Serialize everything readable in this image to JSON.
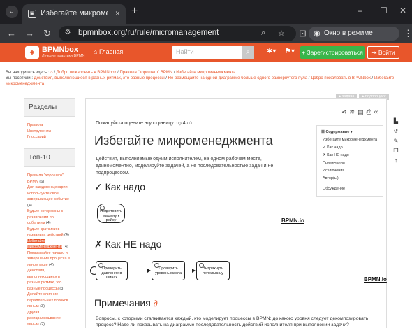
{
  "browser": {
    "tab_title": "Избегайте микроменеджме",
    "tab_close": "×",
    "new_tab": "+",
    "url": "bpmnbox.org/ru/rule/micromanagement",
    "incognito_label": "Окно в режиме инкогнито",
    "minimize": "–",
    "maximize": "☐",
    "close": "✕",
    "back": "←",
    "forward": "→",
    "reload": "↻"
  },
  "site": {
    "logo_name": "BPMNbox",
    "logo_tagline": "Лучшие практики BPMN",
    "home_label": "Главная",
    "search_placeholder": "Найти",
    "register_label": "Зарегистрироваться",
    "login_label": "Войти"
  },
  "breadcrumbs": {
    "here_label": "Вы находитесь здесь :",
    "here_items": [
      "Добро пожаловать в BPMNbox",
      "Правила \"хорошего\" BPMN",
      "Избегайте микроменеджмента"
    ],
    "visited_label": "Вы посетили :",
    "visited_items": [
      "Действия, выполняющиеся в разных ритмах, это разные процессы",
      "Не размещайте на одной диаграмме больше одного развернутого пула",
      "Добро пожаловать в BPMNbox",
      "Избегайте микроменеджмента"
    ]
  },
  "tags": [
    "задача",
    "подпроцесс"
  ],
  "sidebar": {
    "sections_title": "Разделы",
    "sections": [
      "Правила",
      "Инструменты",
      "Глоссарий"
    ],
    "top10_title": "Топ-10",
    "top10": [
      {
        "label": "Правила \"хорошего\" BPMN",
        "count": "(6)",
        "active": false
      },
      {
        "label": "Для каждого сценария используйте свое завершающее событие",
        "count": "(4)",
        "active": false
      },
      {
        "label": "Будьте осторожны с развилками по событиям",
        "count": "(4)",
        "active": false
      },
      {
        "label": "Будьте краткими в названиях действий",
        "count": "(4)",
        "active": false
      },
      {
        "label": "Избегайте микроменеджмента",
        "count": "(4)",
        "active": true
      },
      {
        "label": "Показывайте начало и завершение процесса в явном виде",
        "count": "(4)",
        "active": false
      },
      {
        "label": "Действия, выполняющиеся в разных ритмах, это разные процессы",
        "count": "(3)",
        "active": false
      },
      {
        "label": "Делайте слияние параллельных потоков явным",
        "count": "(3)",
        "active": false
      },
      {
        "label": "Другая растаралельвание явным",
        "count": "(2)",
        "active": false
      }
    ]
  },
  "main": {
    "rate_label": "Пожалуйста оцените эту страницу:",
    "rate_count": "4",
    "title": "Избегайте микроменеджмента",
    "description": "Действия, выполняемые одним исполнителем, на одном рабочем месте, единомоментно, моделируйте задачей, а не последовательностью задач и не подпроцессом.",
    "good_heading": "✓ Как надо",
    "bad_heading": "✗ Как НЕ надо",
    "notes_heading": "Примечания",
    "notes_text": "Вопросы, с которыми сталкивается каждый, кто моделирует процессы в BPMN: до какого уровня следует декомпозировать процесс? Надо ли показывать на диаграмме последовательность действий исполнителя при выполнении задачи?",
    "good_diagram": {
      "task": "Подготовить машину к рейсу",
      "brand": "BPMN.io"
    },
    "bad_diagram": {
      "tasks": [
        "Проверить давление в шинах",
        "Проверить уровень масла",
        "Вытряхнуть пепельницу"
      ],
      "brand": "BPMN.io"
    }
  },
  "toc": {
    "title": "☰ Содержание ▾",
    "items": [
      "Избегайте микроменеджмента",
      "✓ Как надо",
      "✗ Как НЕ надо",
      "Примечания",
      "Исключения",
      "Автор(ы)",
      "Обсуждение"
    ]
  }
}
